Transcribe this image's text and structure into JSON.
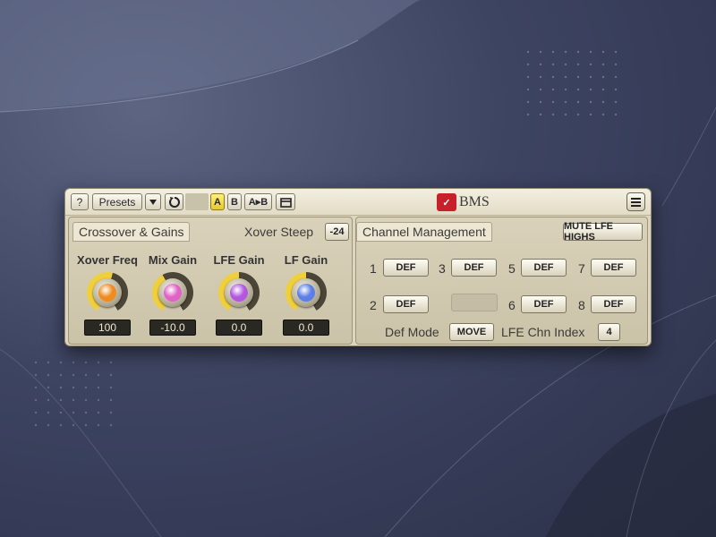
{
  "toolbar": {
    "help_label": "?",
    "presets_label": "Presets",
    "dropdown_icon": "triangle-down-icon",
    "reset_icon": "undo-icon",
    "a_label": "A",
    "b_label": "B",
    "ab_label": "A▸B",
    "menu_icon": "hamburger-icon",
    "brand_logo": "BMS-logo",
    "brand_label": "BMS"
  },
  "crossover": {
    "tab_label": "Crossover & Gains",
    "steep_label": "Xover Steep",
    "steep_value": "-24",
    "knobs": [
      {
        "label": "Xover Freq",
        "value": "100",
        "color": "#f08c1f",
        "level": 0.55
      },
      {
        "label": "Mix Gain",
        "value": "-10.0",
        "color": "#e062c6",
        "level": 0.4
      },
      {
        "label": "LFE Gain",
        "value": "0.0",
        "color": "#b357e0",
        "level": 0.5
      },
      {
        "label": "LF Gain",
        "value": "0.0",
        "color": "#5c7fe6",
        "level": 0.5
      }
    ]
  },
  "channel": {
    "tab_label": "Channel Management",
    "mute_label": "MUTE LFE HIGHS",
    "channels": [
      {
        "num": "1",
        "value": "DEF"
      },
      {
        "num": "2",
        "value": "DEF"
      },
      {
        "num": "3",
        "value": "DEF"
      },
      {
        "num": "5",
        "value": "DEF"
      },
      {
        "num": "6",
        "value": "DEF"
      },
      {
        "num": "7",
        "value": "DEF"
      },
      {
        "num": "8",
        "value": "DEF"
      }
    ],
    "def_mode_label": "Def Mode",
    "def_mode_value": "MOVE",
    "lfe_index_label": "LFE Chn Index",
    "lfe_index_value": "4"
  }
}
